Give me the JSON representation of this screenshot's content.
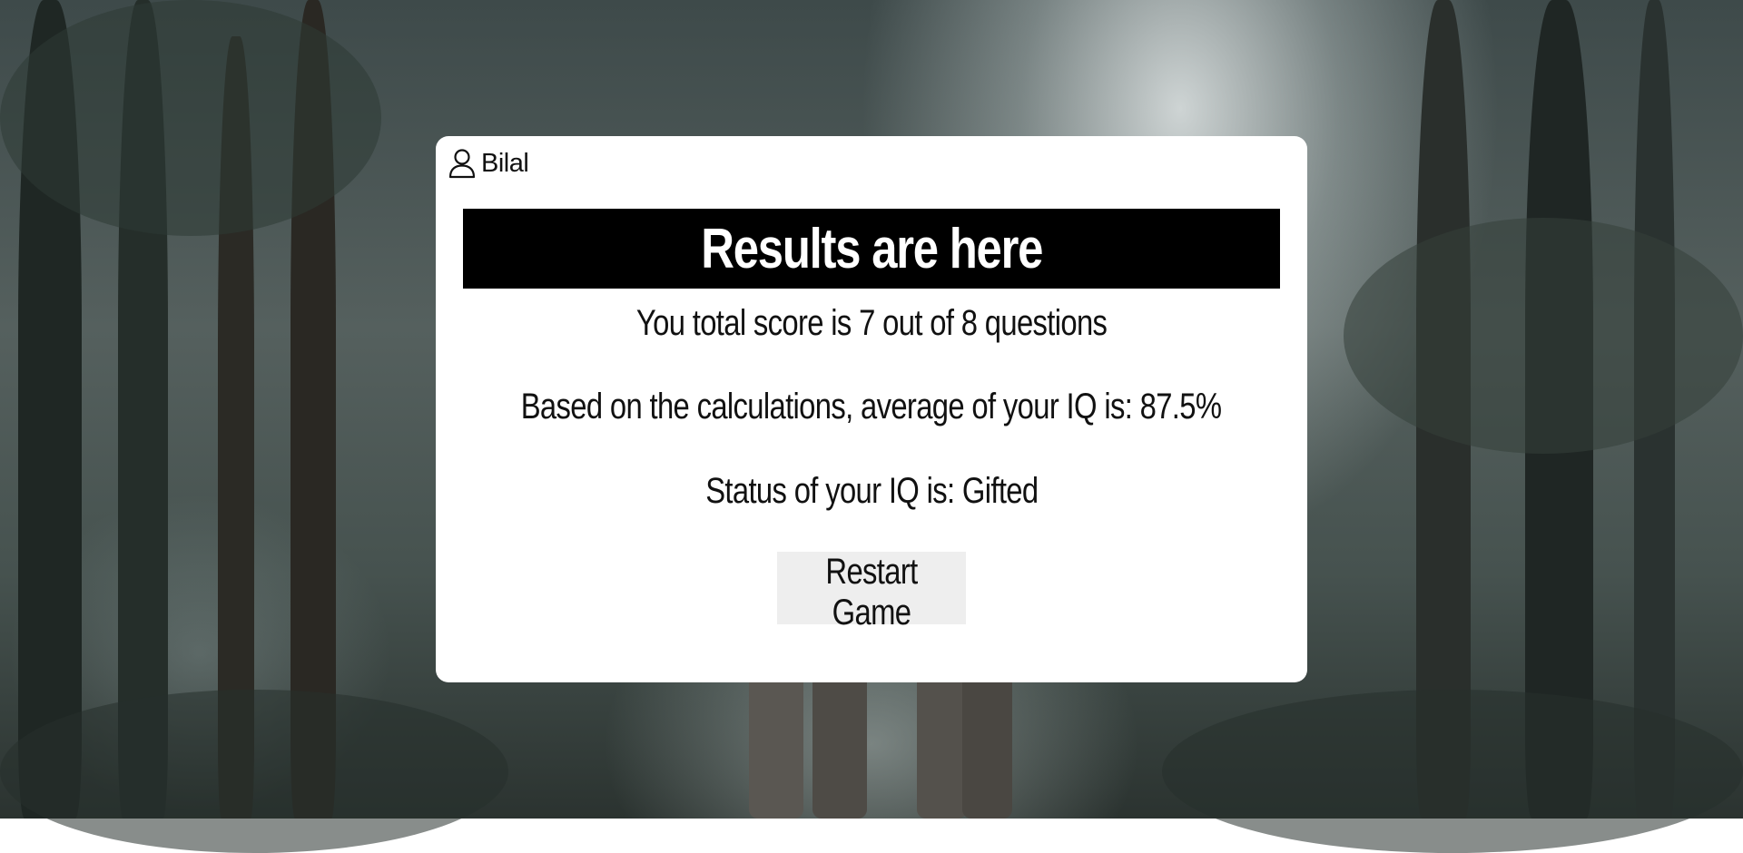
{
  "user": {
    "icon": "user-icon",
    "name": "Bilal"
  },
  "results": {
    "title": "Results are here",
    "score_line": "You total score is 7  out of 8 questions",
    "iq_average_line": "Based on the calculations, average of your IQ is: 87.5%",
    "iq_status_line": "Status of your IQ is: Gifted"
  },
  "actions": {
    "restart_label": "Restart Game"
  },
  "colors": {
    "card_background": "#ffffff",
    "banner_background": "#000000",
    "banner_text": "#ffffff",
    "button_background": "#eeeeee"
  }
}
